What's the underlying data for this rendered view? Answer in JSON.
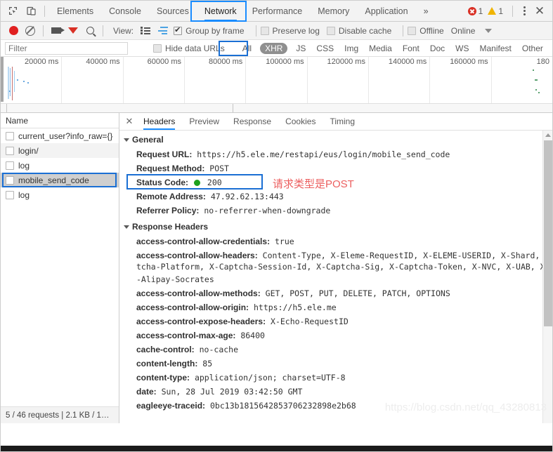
{
  "window": {
    "tabs": [
      {
        "label": "Elements",
        "active": false
      },
      {
        "label": "Console",
        "active": false
      },
      {
        "label": "Sources",
        "active": false
      },
      {
        "label": "Network",
        "active": true
      },
      {
        "label": "Performance",
        "active": false
      },
      {
        "label": "Memory",
        "active": false
      },
      {
        "label": "Application",
        "active": false
      }
    ],
    "more_label": "»",
    "error_count": "1",
    "warning_count": "1",
    "inspect_icon": "inspect-element-icon",
    "device_icon": "device-toolbar-icon",
    "menu_icon": "more-options-icon",
    "close_icon": "close-devtools-icon"
  },
  "toolbar": {
    "record_icon": "record-button-icon",
    "clear_icon": "clear-button-icon",
    "capture_screenshots_icon": "camera-icon",
    "filter_icon": "filter-funnel-icon",
    "search_icon": "search-icon",
    "view_label": "View:",
    "view_list_icon": "list-view-icon",
    "view_waterfall_icon": "waterfall-view-icon",
    "group_by_frame": {
      "label": "Group by frame",
      "checked": true
    },
    "preserve_log": {
      "label": "Preserve log",
      "checked": false
    },
    "disable_cache": {
      "label": "Disable cache",
      "checked": false
    },
    "offline": {
      "label": "Offline",
      "checked": false
    },
    "throttling_value": "Online",
    "throttling_caret_icon": "chevron-down-icon"
  },
  "filterbar": {
    "input_value": "",
    "placeholder": "Filter",
    "hide_data_urls": {
      "label": "Hide data URLs",
      "checked": false
    },
    "types": [
      {
        "label": "All",
        "selected": false
      },
      {
        "label": "XHR",
        "selected": true
      },
      {
        "label": "JS",
        "selected": false
      },
      {
        "label": "CSS",
        "selected": false
      },
      {
        "label": "Img",
        "selected": false
      },
      {
        "label": "Media",
        "selected": false
      },
      {
        "label": "Font",
        "selected": false
      },
      {
        "label": "Doc",
        "selected": false
      },
      {
        "label": "WS",
        "selected": false
      },
      {
        "label": "Manifest",
        "selected": false
      },
      {
        "label": "Other",
        "selected": false
      }
    ]
  },
  "overview": {
    "ticks": [
      "20000 ms",
      "40000 ms",
      "60000 ms",
      "80000 ms",
      "100000 ms",
      "120000 ms",
      "140000 ms",
      "160000 ms",
      "180"
    ]
  },
  "requests": {
    "column_header": "Name",
    "rows": [
      {
        "name": "current_user?info_raw={}",
        "selected": false
      },
      {
        "name": "login/",
        "selected": false
      },
      {
        "name": "log",
        "selected": false
      },
      {
        "name": "mobile_send_code",
        "selected": true
      },
      {
        "name": "log",
        "selected": false
      }
    ],
    "status_text": "5 / 46 requests  |  2.1 KB / 1…"
  },
  "detail": {
    "close_icon": "close-panel-icon",
    "tabs": [
      {
        "label": "Headers",
        "active": true
      },
      {
        "label": "Preview",
        "active": false
      },
      {
        "label": "Response",
        "active": false
      },
      {
        "label": "Cookies",
        "active": false
      },
      {
        "label": "Timing",
        "active": false
      }
    ],
    "general": {
      "title": "General",
      "rows": [
        {
          "key": "Request URL:",
          "value": "https://h5.ele.me/restapi/eus/login/mobile_send_code"
        },
        {
          "key": "Request Method:",
          "value": "POST"
        },
        {
          "key": "Status Code:",
          "value": "200",
          "status_dot": "#1ea11e"
        },
        {
          "key": "Remote Address:",
          "value": "47.92.62.13:443"
        },
        {
          "key": "Referrer Policy:",
          "value": "no-referrer-when-downgrade"
        }
      ]
    },
    "response_headers": {
      "title": "Response Headers",
      "rows": [
        {
          "key": "access-control-allow-credentials:",
          "value": "true"
        },
        {
          "key": "access-control-allow-headers:",
          "value": "Content-Type, X-Eleme-RequestID, X-ELEME-USERID, X-Shard, X-C",
          "continuation": [
            "tcha-Platform, X-Captcha-Session-Id, X-Captcha-Sig, X-Captcha-Token, X-NVC, X-UAB, X-UA,",
            "-Alipay-Socrates"
          ]
        },
        {
          "key": "access-control-allow-methods:",
          "value": "GET, POST, PUT, DELETE, PATCH, OPTIONS"
        },
        {
          "key": "access-control-allow-origin:",
          "value": "https://h5.ele.me"
        },
        {
          "key": "access-control-expose-headers:",
          "value": "X-Echo-RequestID"
        },
        {
          "key": "access-control-max-age:",
          "value": "86400"
        },
        {
          "key": "cache-control:",
          "value": "no-cache"
        },
        {
          "key": "content-length:",
          "value": "85"
        },
        {
          "key": "content-type:",
          "value": "application/json; charset=UTF-8"
        },
        {
          "key": "date:",
          "value": "Sun, 28 Jul 2019 03:42:50 GMT"
        },
        {
          "key": "eagleeye-traceid:",
          "value": "0bc13b1815642853706232898e2b68"
        }
      ]
    },
    "annotation": "请求类型是POST",
    "annotation_color": "#ec5f5f"
  },
  "watermark": "https://blog.csdn.net/qq_43280813"
}
